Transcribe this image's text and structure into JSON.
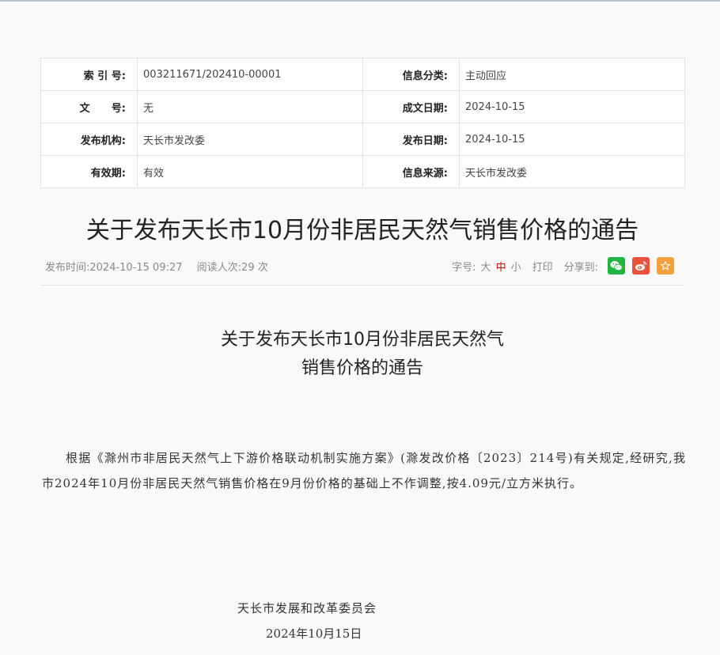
{
  "info_table": {
    "rows": [
      {
        "l1": "索 引 号:",
        "v1": "003211671/202410-00001",
        "l2": "信息分类:",
        "v2": "主动回应"
      },
      {
        "l1": "文      号:",
        "v1": "无",
        "l2": "成文日期:",
        "v2": "2024-10-15"
      },
      {
        "l1": "发布机构:",
        "v1": "天长市发改委",
        "l2": "发布日期:",
        "v2": "2024-10-15"
      },
      {
        "l1": "有效期:",
        "v1": "有效",
        "l2": "信息来源:",
        "v2": "天长市发改委"
      }
    ]
  },
  "article": {
    "title": "关于发布天长市10月份非居民天然气销售价格的通告",
    "publish_time": "发布时间:2024-10-15 09:27",
    "read_count": "阅读人次:29 次",
    "doc_title_line1": "关于发布天长市10月份非居民天然气",
    "doc_title_line2": "销售价格的通告",
    "body": "根据《滁州市非居民天然气上下游价格联动机制实施方案》(滁发改价格〔2023〕214号)有关规定,经研究,我市2024年10月份非居民天然气销售价格在9月份价格的基础上不作调整,按4.09元/立方米执行。",
    "signature": "天长市发展和改革委员会",
    "date": "2024年10月15日"
  },
  "tools": {
    "font_label": "字号:",
    "size_large": "大",
    "size_medium": "中",
    "size_small": "小",
    "print": "打印",
    "share_label": "分享到:",
    "share_icons": [
      "wechat-icon",
      "weibo-icon",
      "favorite-icon"
    ]
  },
  "colors": {
    "wechat": "#20b53f",
    "weibo": "#e8523a",
    "favorite": "#f2a13a",
    "active_size": "#cc0000"
  }
}
